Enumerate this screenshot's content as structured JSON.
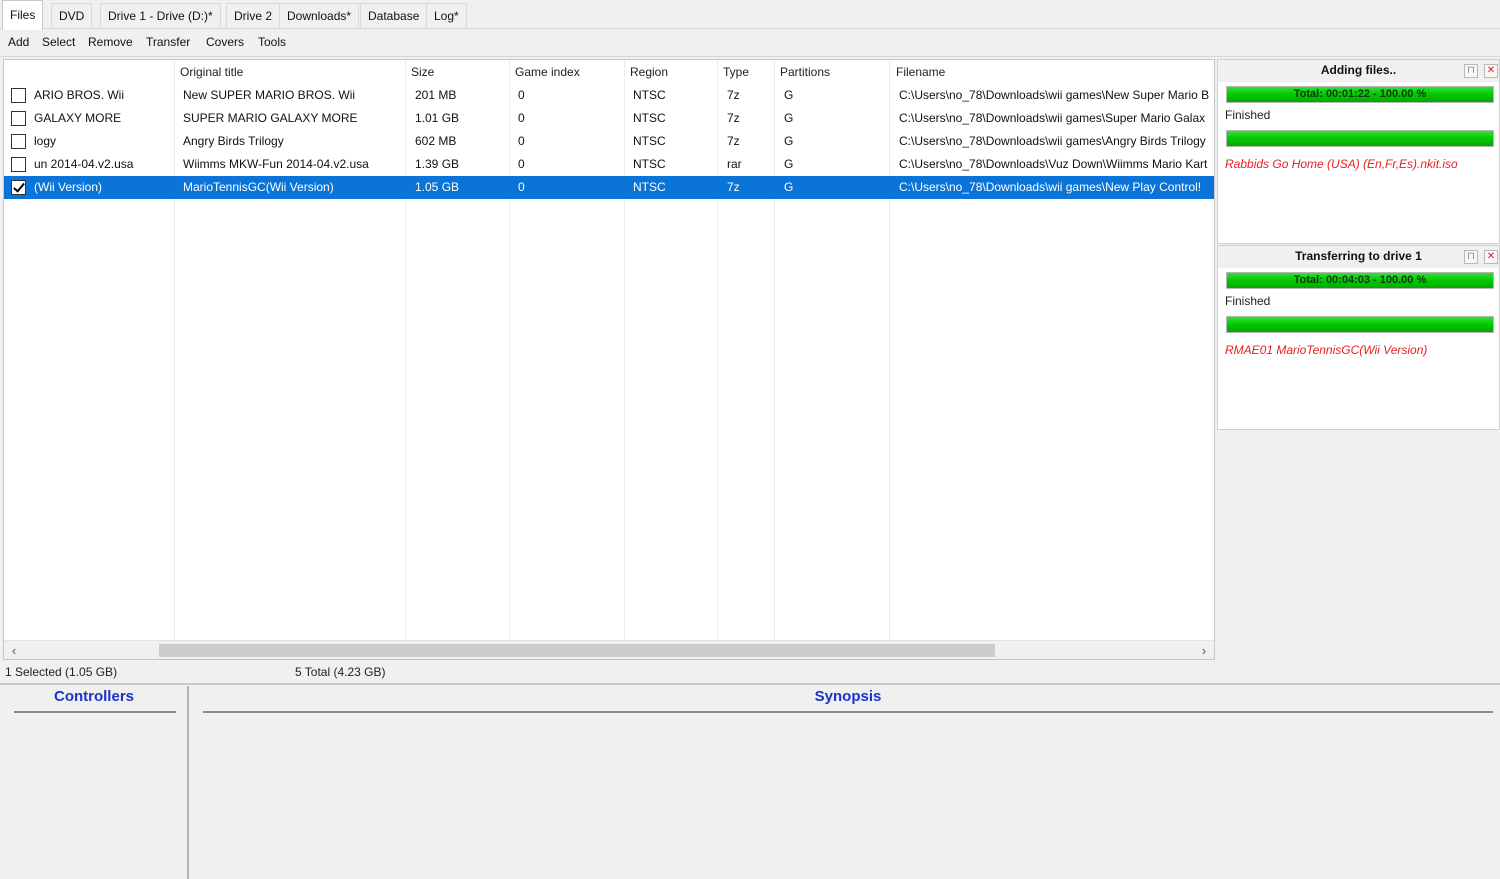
{
  "tabs": [
    {
      "label": "Files",
      "active": true
    },
    {
      "label": "DVD"
    },
    {
      "label": "Drive 1 - Drive (D:)*"
    },
    {
      "label": "Drive 2"
    },
    {
      "label": "Downloads*"
    },
    {
      "label": "Database"
    },
    {
      "label": "Log*"
    }
  ],
  "menu": [
    "Add",
    "Select",
    "Remove",
    "Transfer",
    "Covers",
    "Tools"
  ],
  "table": {
    "columns": [
      "",
      "Original title",
      "Size",
      "Game index",
      "Region",
      "Type",
      "Partitions",
      "Filename"
    ],
    "rows": [
      {
        "checked": false,
        "title": "ARIO BROS. Wii",
        "original": "New SUPER MARIO BROS. Wii",
        "size": "201 MB",
        "index": "0",
        "region": "NTSC",
        "type": "7z",
        "partitions": "G",
        "filename": "C:\\Users\\no_78\\Downloads\\wii games\\New Super Mario B",
        "selected": false
      },
      {
        "checked": false,
        "title": "GALAXY MORE",
        "original": "SUPER MARIO GALAXY MORE",
        "size": "1.01 GB",
        "index": "0",
        "region": "NTSC",
        "type": "7z",
        "partitions": "G",
        "filename": "C:\\Users\\no_78\\Downloads\\wii games\\Super Mario Galax",
        "selected": false
      },
      {
        "checked": false,
        "title": "logy",
        "original": "Angry Birds Trilogy",
        "size": "602 MB",
        "index": "0",
        "region": "NTSC",
        "type": "7z",
        "partitions": "G",
        "filename": "C:\\Users\\no_78\\Downloads\\wii games\\Angry Birds Trilogy",
        "selected": false
      },
      {
        "checked": false,
        "title": "un 2014-04.v2.usa",
        "original": "Wiimms MKW-Fun 2014-04.v2.usa",
        "size": "1.39 GB",
        "index": "0",
        "region": "NTSC",
        "type": "rar",
        "partitions": "G",
        "filename": "C:\\Users\\no_78\\Downloads\\Vuz Down\\Wiimms Mario Kart",
        "selected": false
      },
      {
        "checked": true,
        "title": "(Wii Version)",
        "original": "MarioTennisGC(Wii Version)",
        "size": "1.05 GB",
        "index": "0",
        "region": "NTSC",
        "type": "7z",
        "partitions": "G",
        "filename": "C:\\Users\\no_78\\Downloads\\wii games\\New Play Control!",
        "selected": true
      }
    ]
  },
  "scroll": {
    "left_arrow": "‹",
    "right_arrow": "›"
  },
  "status": {
    "selected": "1 Selected (1.05 GB)",
    "total": "5 Total (4.23 GB)"
  },
  "panels": {
    "controllers": "Controllers",
    "synopsis": "Synopsis"
  },
  "adding": {
    "title": "Adding files..",
    "bar1": "Total: 00:01:22 - 100.00 %",
    "bar1_progress": 1.0,
    "status": "Finished",
    "bar2_progress": 1.0,
    "current": "Rabbids Go Home (USA) (En,Fr,Es).nkit.iso"
  },
  "transfer": {
    "title": "Transferring to drive 1",
    "bar1": "Total: 00:04:03 - 100.00 %",
    "bar1_progress": 1.0,
    "status": "Finished",
    "bar2_progress": 1.0,
    "current": "RMAE01 MarioTennisGC(Wii Version)"
  },
  "colors": {
    "accent": "#0a74d8",
    "progress": "#00c800",
    "error_text": "#e62020",
    "panel_title": "#1a33cc"
  }
}
